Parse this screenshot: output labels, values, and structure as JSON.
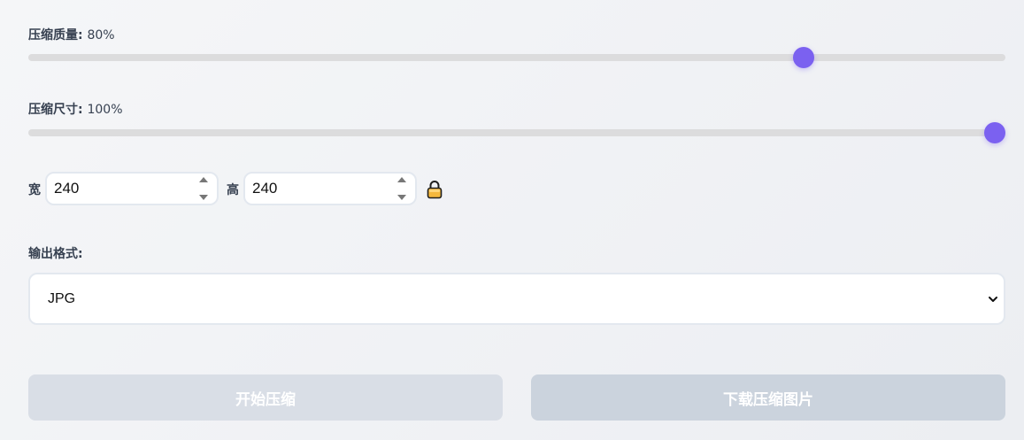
{
  "quality": {
    "label": "压缩质量:",
    "value_text": "80%",
    "value": 80,
    "min": 0,
    "max": 100
  },
  "size": {
    "label": "压缩尺寸:",
    "value_text": "100%",
    "value": 100,
    "min": 0,
    "max": 100
  },
  "dimensions": {
    "width_label": "宽",
    "width_value": "240",
    "height_label": "高",
    "height_value": "240",
    "lock_icon": "lock-icon",
    "locked": true
  },
  "format": {
    "label": "输出格式:",
    "selected": "JPG"
  },
  "buttons": {
    "start_label": "开始压缩",
    "download_label": "下载压缩图片"
  },
  "colors": {
    "accent": "#7b61f0",
    "track": "#dcdcdd",
    "lock_body": "#f5b83d",
    "button_start_bg": "#d9dee6",
    "button_download_bg": "#cbd3dd"
  }
}
